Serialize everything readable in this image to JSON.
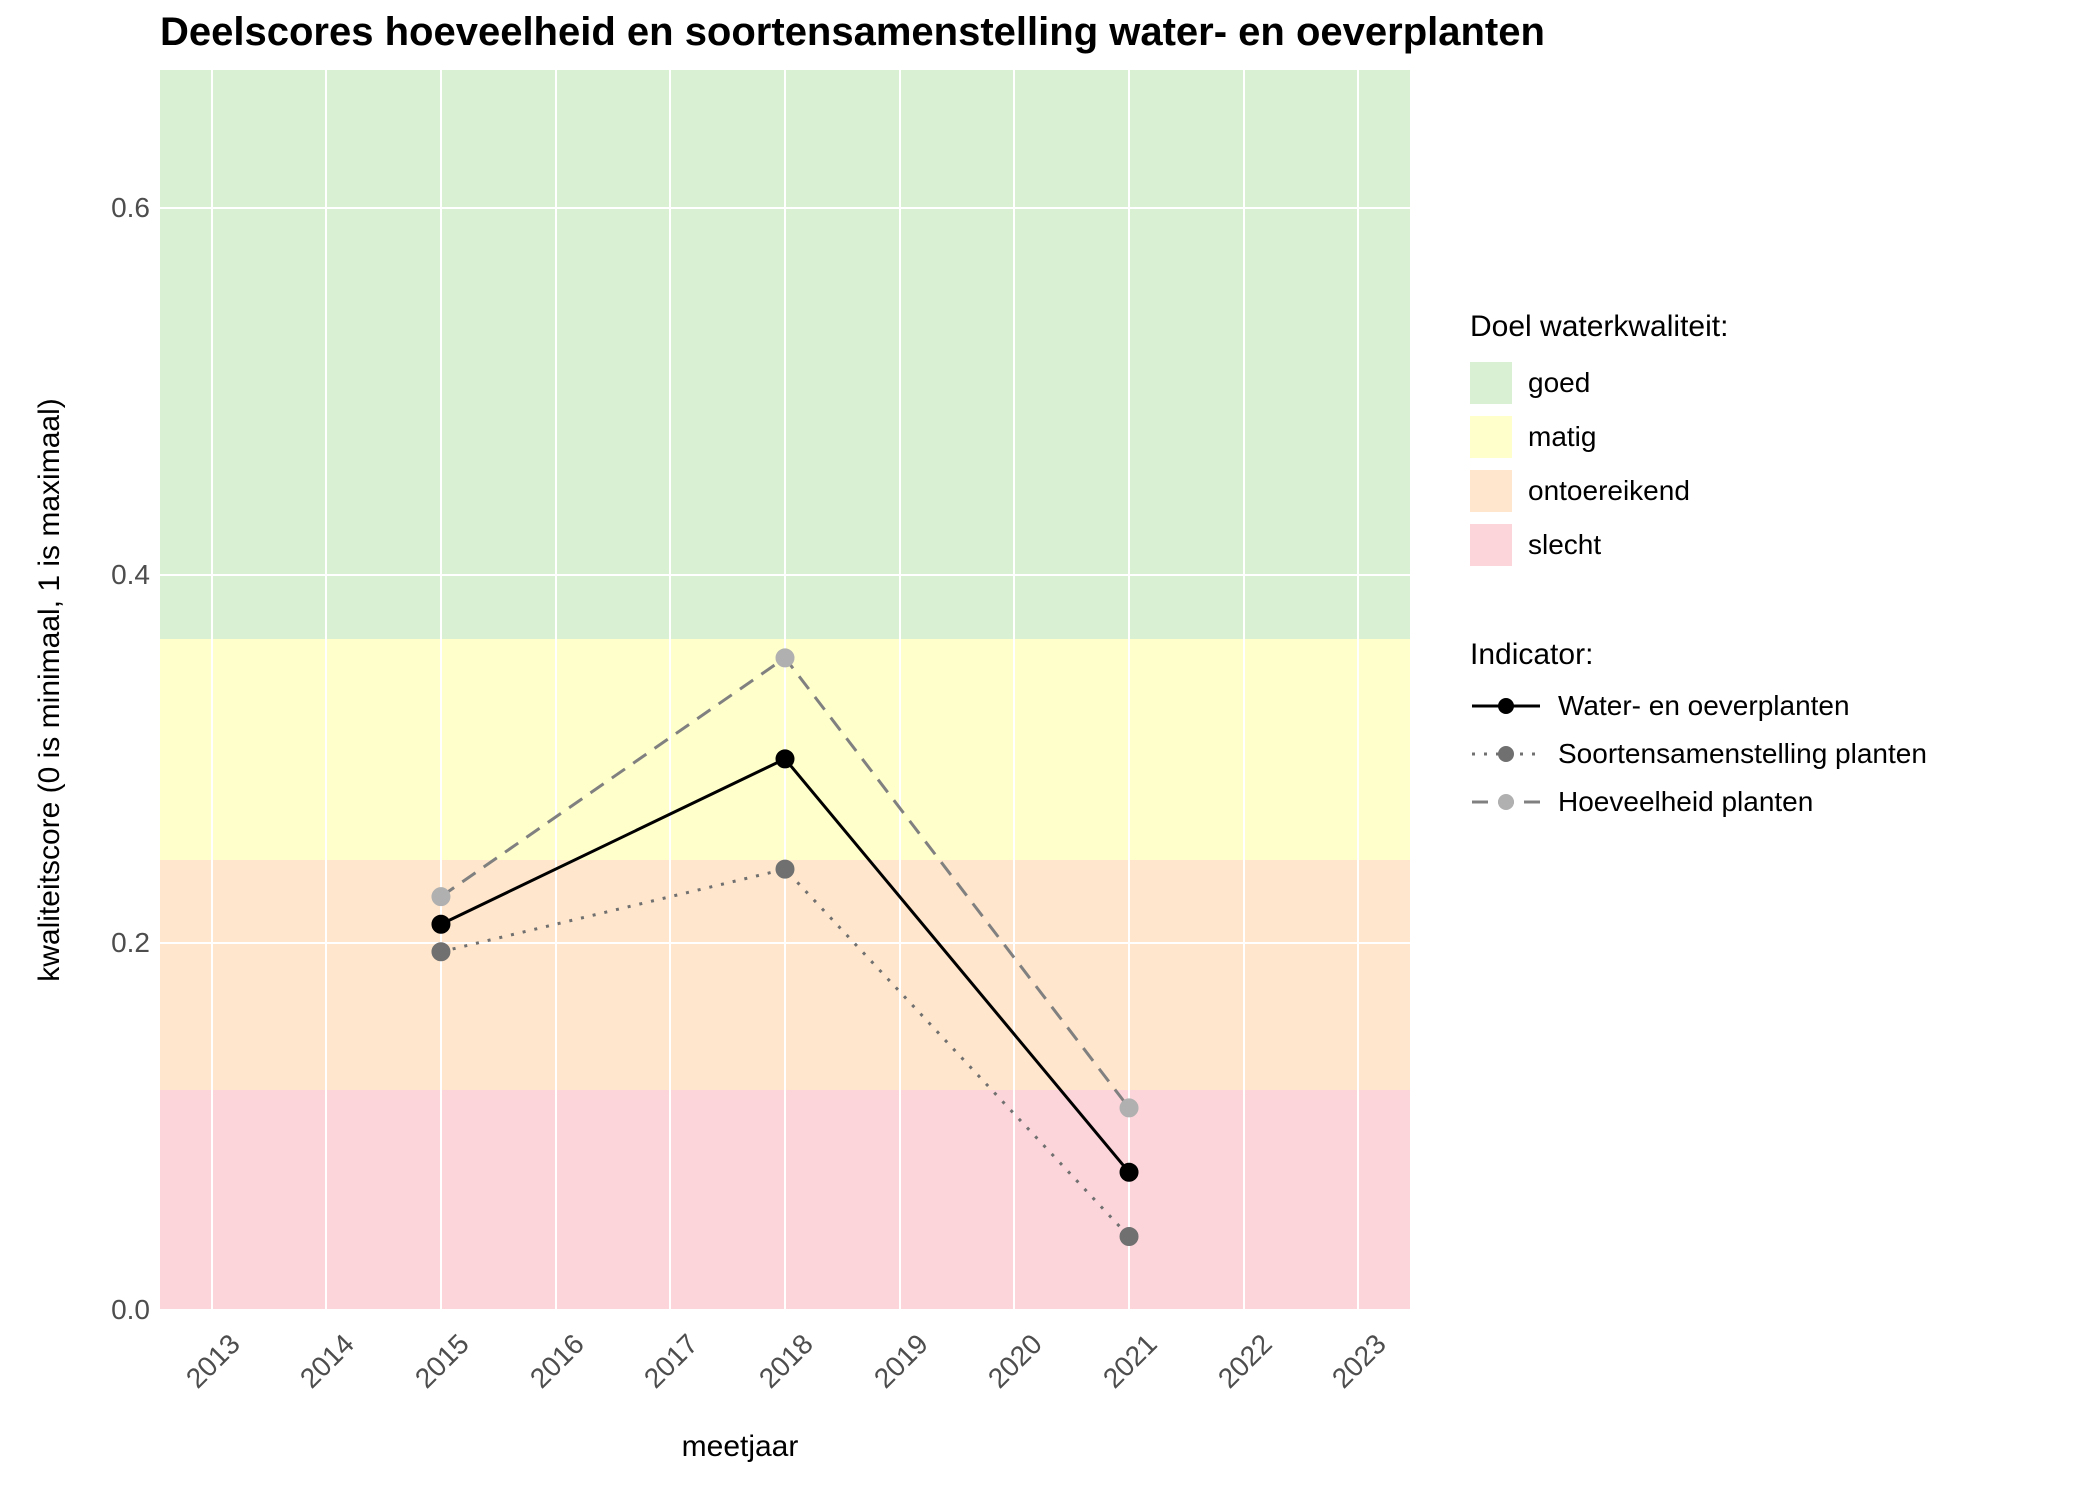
{
  "chart_data": {
    "type": "line",
    "title": "Deelscores hoeveelheid en soortensamenstelling water- en oeverplanten",
    "xlabel": "meetjaar",
    "ylabel": "kwaliteitscore (0 is minimaal, 1 is maximaal)",
    "x_ticks": [
      "2013",
      "2014",
      "2015",
      "2016",
      "2017",
      "2018",
      "2019",
      "2020",
      "2021",
      "2022",
      "2023"
    ],
    "y_ticks": [
      "0.0",
      "0.2",
      "0.4",
      "0.6"
    ],
    "xlim": [
      2012.55,
      2023.45
    ],
    "ylim": [
      0.0,
      0.675
    ],
    "bands_legend_title": "Doel waterkwaliteit:",
    "bands": [
      {
        "label": "goed",
        "color": "#d9f0d3",
        "from": 0.365,
        "to": 0.675
      },
      {
        "label": "matig",
        "color": "#ffffcc",
        "from": 0.245,
        "to": 0.365
      },
      {
        "label": "ontoereikend",
        "color": "#ffe6cc",
        "from": 0.12,
        "to": 0.245
      },
      {
        "label": "slecht",
        "color": "#fbd5da",
        "from": 0.0,
        "to": 0.12
      }
    ],
    "series_legend_title": "Indicator:",
    "series": [
      {
        "name": "Water- en oeverplanten",
        "line_style": "solid",
        "point_color": "#000000",
        "line_color": "#000000",
        "x": [
          2015,
          2018,
          2021
        ],
        "y": [
          0.21,
          0.3,
          0.075
        ]
      },
      {
        "name": "Soortensamenstelling planten",
        "line_style": "dotted",
        "point_color": "#707070",
        "line_color": "#707070",
        "x": [
          2015,
          2018,
          2021
        ],
        "y": [
          0.195,
          0.24,
          0.04
        ]
      },
      {
        "name": "Hoeveelheid planten",
        "line_style": "dashed",
        "point_color": "#b0b0b0",
        "line_color": "#808080",
        "x": [
          2015,
          2018,
          2021
        ],
        "y": [
          0.225,
          0.355,
          0.11
        ]
      }
    ]
  }
}
